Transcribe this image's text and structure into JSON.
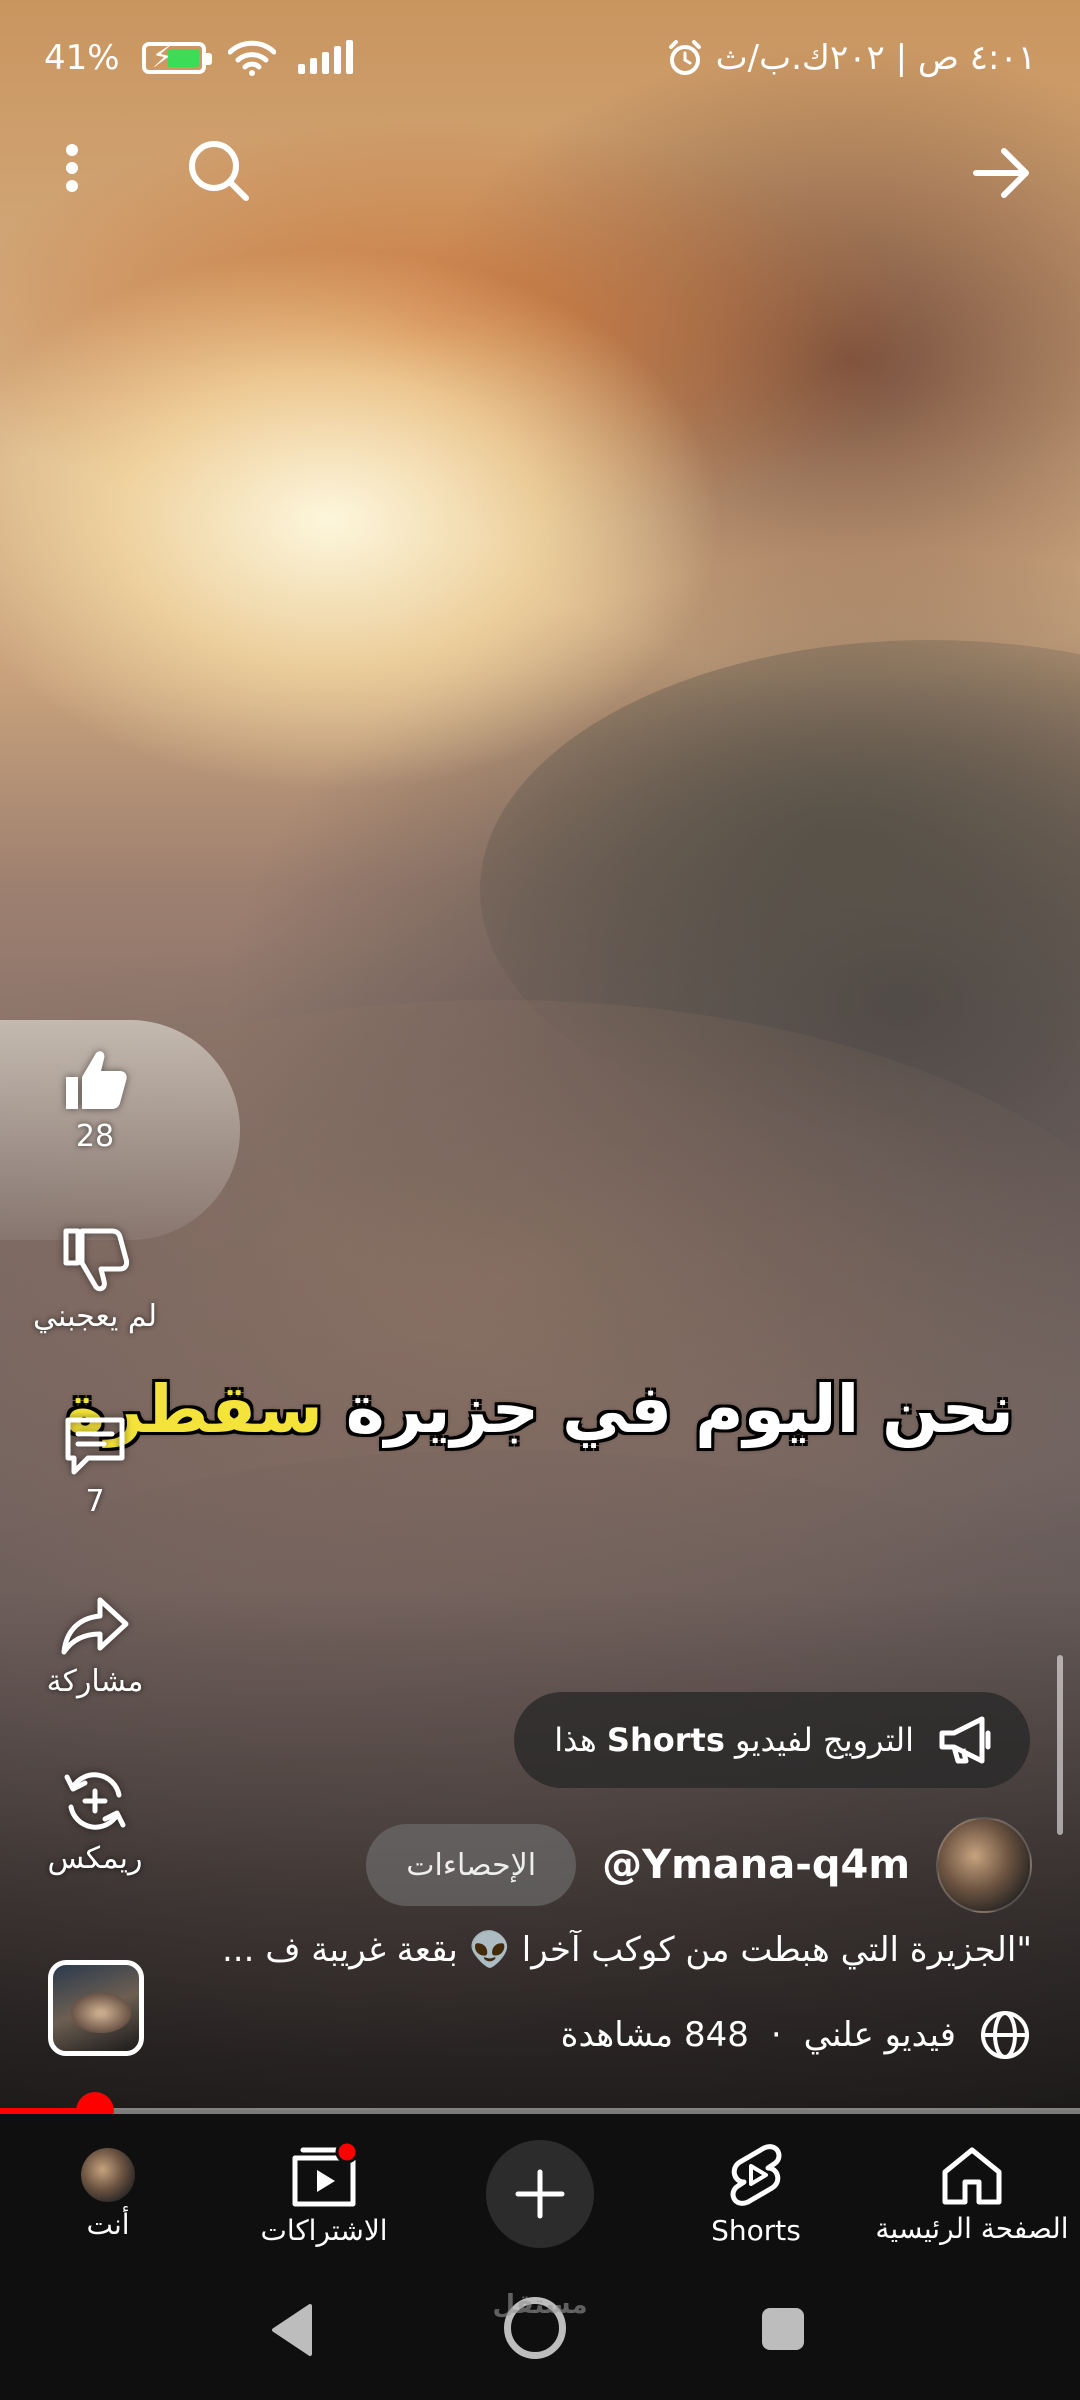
{
  "status_bar": {
    "time_text": "٤:٠١ ص | ٢٠٢ك.ب/ث",
    "battery_text": "41%"
  },
  "caption": {
    "text_main": "نحن اليوم في جزيرة ",
    "text_highlight": "سقطرة"
  },
  "actions": {
    "like_count": "28",
    "dislike_label": "لم يعجبني",
    "comments_count": "7",
    "share_label": "مشاركة",
    "remix_label": "ريمكس"
  },
  "promote": {
    "text_before": "الترويج لفيديو ",
    "text_bold": "Shorts",
    "text_after": " هذا"
  },
  "channel": {
    "handle": "@Ymana-q4m",
    "stats_label": "الإحصاءات"
  },
  "description": "\"الجزيرة التي هبطت من كوكب آخرا 👽 بقعة غريبة ف ...",
  "meta": {
    "visibility": "فيديو علني",
    "separator": "·",
    "views": "848 مشاهدة"
  },
  "playback": {
    "progress_fraction": 0.088
  },
  "bottom_nav": {
    "home_label": "الصفحة الرئيسية",
    "shorts_label": "Shorts",
    "subscriptions_label": "الاشتراكات",
    "you_label": "أنت"
  },
  "watermark": "مستقل",
  "colors": {
    "accent_red": "#ff0000",
    "caption_highlight": "#f4e33b"
  }
}
